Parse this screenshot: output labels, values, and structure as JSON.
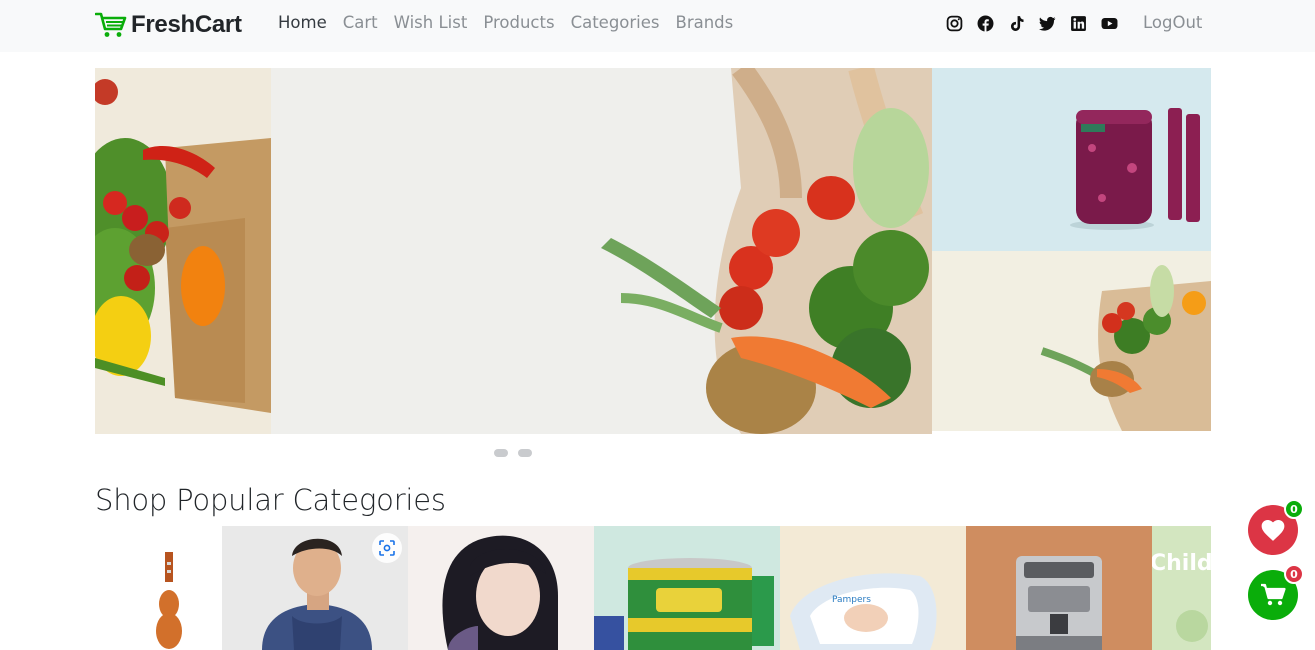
{
  "navbar": {
    "brand": "FreshCart",
    "links": [
      "Home",
      "Cart",
      "Wish List",
      "Products",
      "Categories",
      "Brands"
    ],
    "active_link": "Home",
    "social_icons": [
      "instagram-icon",
      "facebook-icon",
      "tiktok-icon",
      "twitter-icon",
      "linkedin-icon",
      "youtube-icon"
    ],
    "logout": "LogOut"
  },
  "slider": {
    "dot_count": 2
  },
  "categories": {
    "title": "Shop Popular Categories"
  },
  "floating": {
    "wishlist_count": "0",
    "cart_count": "0"
  },
  "colors": {
    "brand_green": "#0aad0a",
    "wishlist_red": "#dc3545",
    "navbar_bg": "#f8f9fa"
  }
}
